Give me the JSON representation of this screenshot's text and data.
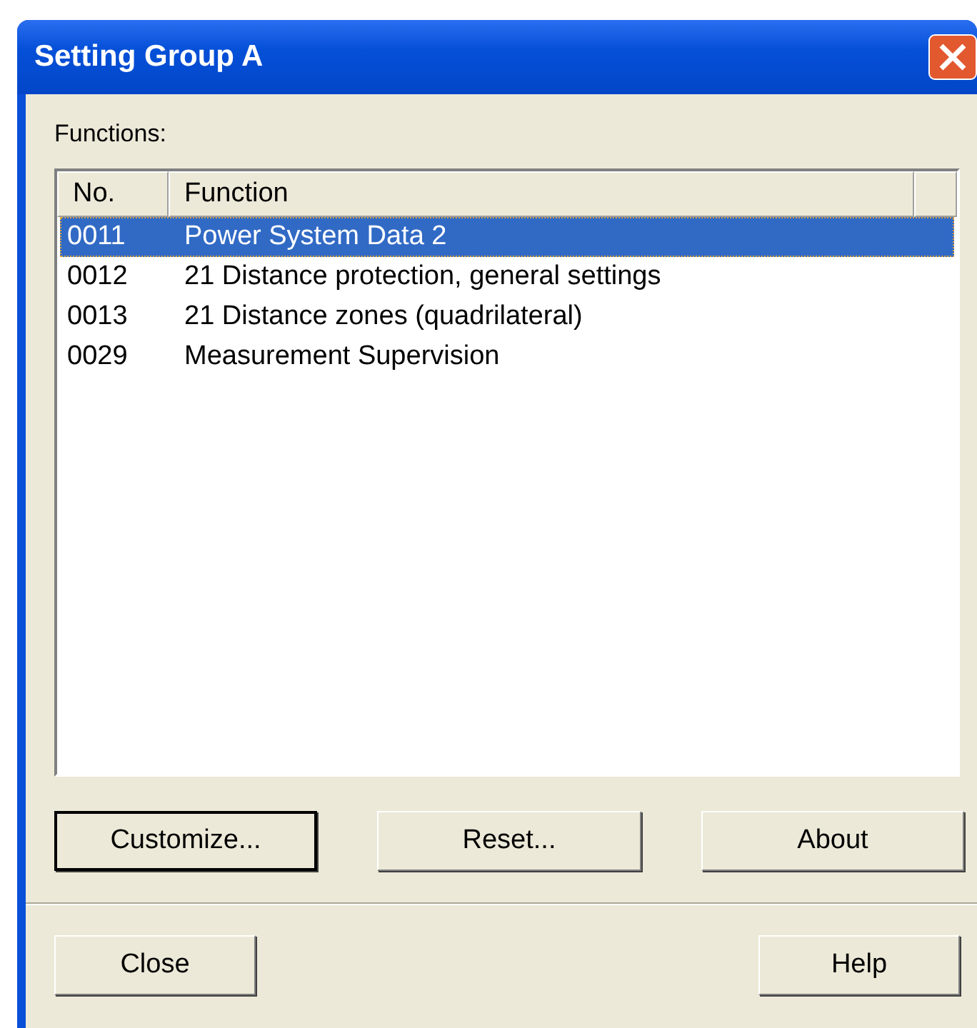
{
  "window": {
    "title": "Setting Group A"
  },
  "functions_label": "Functions:",
  "table": {
    "columns": [
      "No.",
      "Function"
    ],
    "rows": [
      {
        "no": "0011",
        "function": "Power System Data 2",
        "selected": true
      },
      {
        "no": "0012",
        "function": "21 Distance protection, general settings",
        "selected": false
      },
      {
        "no": "0013",
        "function": "21 Distance zones (quadrilateral)",
        "selected": false
      },
      {
        "no": "0029",
        "function": "Measurement Supervision",
        "selected": false
      }
    ]
  },
  "buttons": [
    {
      "label": "Customize...",
      "default": true
    },
    {
      "label": "Reset...",
      "default": false
    },
    {
      "label": "About",
      "default": false
    }
  ],
  "footer_buttons": [
    "Close",
    "Help"
  ]
}
